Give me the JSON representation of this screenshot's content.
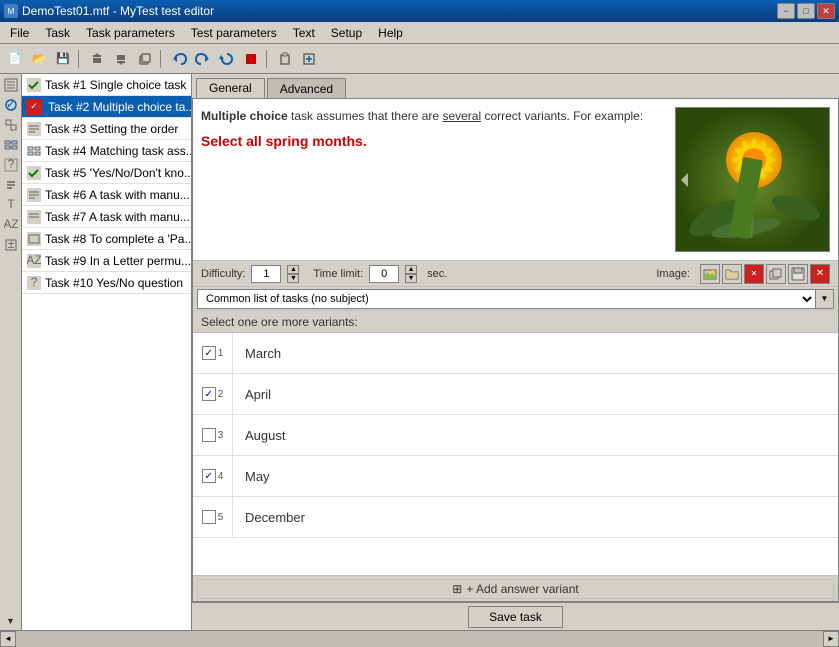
{
  "titleBar": {
    "title": "DemoTest01.mtf - MyTest test editor",
    "minBtn": "−",
    "maxBtn": "□",
    "closeBtn": "✕"
  },
  "menuBar": {
    "items": [
      "File",
      "Task",
      "Task parameters",
      "Test parameters",
      "Text",
      "Setup",
      "Help"
    ]
  },
  "toolbar": {
    "buttons": [
      "📄",
      "📂",
      "💾",
      "|",
      "⬆",
      "⬇",
      "📋",
      "|",
      "↩",
      "↻",
      "⟳",
      "⏹",
      "|",
      "📋",
      "📄"
    ]
  },
  "taskList": {
    "items": [
      {
        "id": 1,
        "label": "Task #1 Single choice task",
        "iconType": "green-check",
        "iconText": "✓"
      },
      {
        "id": 2,
        "label": "Task #2 Multiple choice ta...",
        "iconType": "red-check",
        "iconText": "✓",
        "selected": true
      },
      {
        "id": 3,
        "label": "Task #3 Setting the order",
        "iconType": "number-icon",
        "iconText": "3"
      },
      {
        "id": 4,
        "label": "Task #4 Matching task ass...",
        "iconType": "number-icon",
        "iconText": "4"
      },
      {
        "id": 5,
        "label": "Task #5 'Yes/No/Don't kno...",
        "iconType": "green-check",
        "iconText": "✓"
      },
      {
        "id": 6,
        "label": "Task #6 A task with manu...",
        "iconType": "number-icon",
        "iconText": "6"
      },
      {
        "id": 7,
        "label": "Task #7 A task with manu...",
        "iconType": "number-icon",
        "iconText": "7"
      },
      {
        "id": 8,
        "label": "Task #8 To complete a 'Pa...",
        "iconType": "number-icon",
        "iconText": "8"
      },
      {
        "id": 9,
        "label": "Task #9 In a Letter permu...",
        "iconType": "number-icon",
        "iconText": "9"
      },
      {
        "id": 10,
        "label": "Task #10 Yes/No question",
        "iconType": "number-icon",
        "iconText": "10"
      }
    ]
  },
  "tabs": {
    "items": [
      "General",
      "Advanced"
    ],
    "active": "General"
  },
  "questionArea": {
    "textPart1": "Multiple choice",
    "textPart2": " task assumes that there are ",
    "textUnderlined": "several",
    "textPart3": " correct variants. For example:",
    "instruction": "Select all spring months."
  },
  "settings": {
    "difficultyLabel": "Difficulty:",
    "difficultyValue": "1",
    "timeLimitLabel": "Time limit:",
    "timeLimitValue": "0",
    "timeLimitUnit": "sec.",
    "imageLabel": "Image:"
  },
  "imageBtns": [
    "🖼",
    "📁",
    "❌",
    "📋",
    "💾",
    "✕"
  ],
  "subject": {
    "value": "Common list of tasks (no subject)",
    "options": [
      "Common list of tasks (no subject)"
    ]
  },
  "instructionText": "Select one ore more variants:",
  "answers": [
    {
      "id": 1,
      "text": "March",
      "checked": true
    },
    {
      "id": 2,
      "text": "April",
      "checked": true
    },
    {
      "id": 3,
      "text": "August",
      "checked": false
    },
    {
      "id": 4,
      "text": "May",
      "checked": true
    },
    {
      "id": 5,
      "text": "December",
      "checked": false
    }
  ],
  "addVariantBtn": "+ Add answer variant",
  "saveBtn": "Save task"
}
